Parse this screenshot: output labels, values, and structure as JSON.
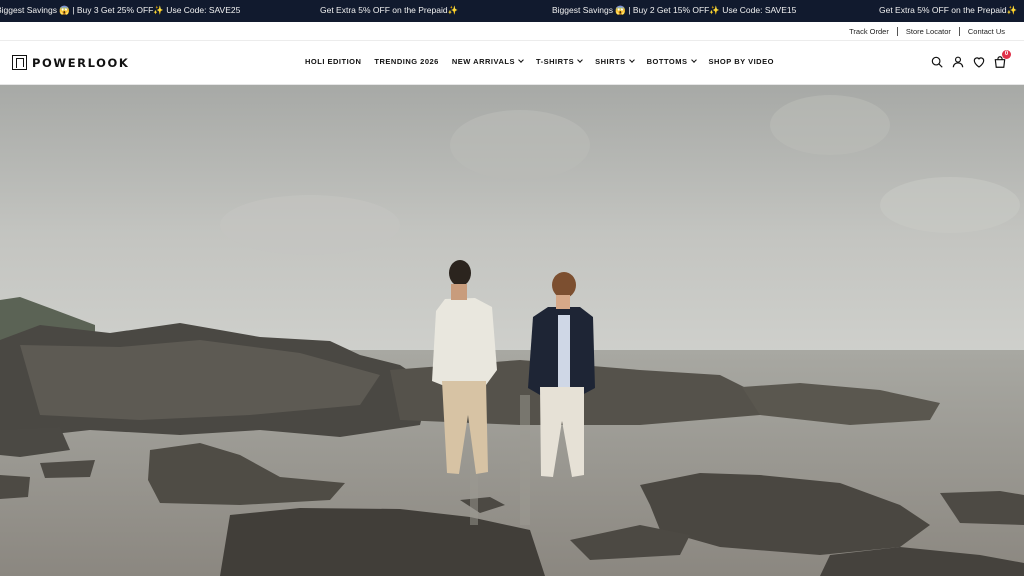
{
  "announcement": {
    "messages": [
      "Biggest Savings 😱 | Buy 3 Get 25% OFF✨ Use Code: SAVE25",
      "Get Extra 5% OFF on the Prepaid✨",
      "Biggest Savings 😱 | Buy 2 Get 15% OFF✨ Use Code: SAVE15",
      "Get Extra 5% OFF on the Prepaid✨"
    ]
  },
  "utility_links": [
    "Track Order",
    "Store Locator",
    "Contact Us"
  ],
  "brand": {
    "name": "POWERLOOK"
  },
  "nav": {
    "items": [
      {
        "label": "HOLI EDITION",
        "has_dropdown": false
      },
      {
        "label": "TRENDING 2026",
        "has_dropdown": false
      },
      {
        "label": "NEW ARRIVALS",
        "has_dropdown": true
      },
      {
        "label": "T-SHIRTS",
        "has_dropdown": true
      },
      {
        "label": "SHIRTS",
        "has_dropdown": true
      },
      {
        "label": "BOTTOMS",
        "has_dropdown": true
      },
      {
        "label": "SHOP BY VIDEO",
        "has_dropdown": false
      }
    ]
  },
  "header_icons": {
    "search": "search-icon",
    "account": "user-icon",
    "wishlist": "heart-icon",
    "cart": "bag-icon",
    "cart_count": "0"
  },
  "colors": {
    "announcement_bg": "#111a2e",
    "badge": "#e0314a"
  }
}
